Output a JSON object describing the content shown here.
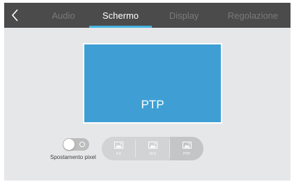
{
  "nav": {
    "back_icon": "chevron-left-icon",
    "tabs": [
      {
        "label": "Audio",
        "active": false
      },
      {
        "label": "Schermo",
        "active": true
      },
      {
        "label": "Display",
        "active": false
      },
      {
        "label": "Regolazione",
        "active": false
      }
    ]
  },
  "preview": {
    "label": "PTP"
  },
  "pixel_shift": {
    "label": "Spostamento pixel",
    "enabled": false
  },
  "aspect_modes": {
    "options": [
      {
        "label": "4:3",
        "icon": "image-icon",
        "selected": false
      },
      {
        "label": "16:9",
        "icon": "image-icon",
        "selected": false
      },
      {
        "label": "PTP",
        "icon": "image-icon",
        "selected": true
      }
    ]
  },
  "colors": {
    "topbar": "#4b4b4b",
    "accent": "#45b3e0",
    "preview": "#3f9fd4",
    "background": "#e6e7e9"
  }
}
